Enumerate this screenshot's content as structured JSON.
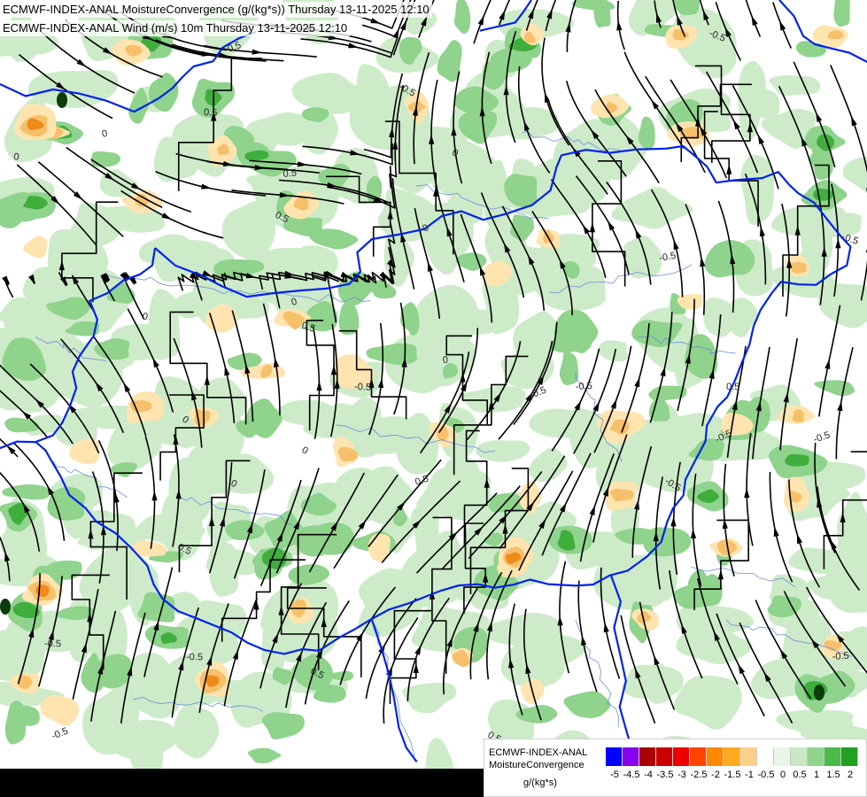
{
  "header": {
    "line1": "ECMWF-INDEX-ANAL MoistureConvergence (g/(kg*s)) Thursday 13-11-2025 12:10",
    "line2": "ECMWF-INDEX-ANAL Wind (m/s) 10m Thursday 13-11-2025 12:10"
  },
  "contour_labels": [
    "0",
    "-0.5",
    "0.5"
  ],
  "legend": {
    "source": "ECMWF-INDEX-ANAL",
    "parameter": "MoistureConvergence",
    "unit": "g/(kg*s)",
    "swatch_colors": [
      "#0000ff",
      "#8800ee",
      "#aa0000",
      "#cc0000",
      "#ee0000",
      "#ff4400",
      "#ff8800",
      "#ffaa22",
      "#ffd08a",
      "#ffffff",
      "#e9f5e8",
      "#c7e8c3",
      "#8fd38c",
      "#4cba49",
      "#22a022"
    ],
    "ticks": [
      "-5",
      "-4.5",
      "-4",
      "-3.5",
      "-3",
      "-2.5",
      "-2",
      "-1.5",
      "-1",
      "-0.5",
      "0",
      "0.5",
      "1",
      "1.5",
      "2"
    ]
  },
  "colors": {
    "border": "#0022ee",
    "river": "#6688dd",
    "streamline": "#000000",
    "convergence_weak": "#cdebc9",
    "convergence_mid": "#8fd38c",
    "convergence_strong": "#3fae3d",
    "divergence_weak": "#ffe4b0",
    "divergence_mid": "#f6c06a",
    "divergence_strong": "#f08a1a"
  }
}
